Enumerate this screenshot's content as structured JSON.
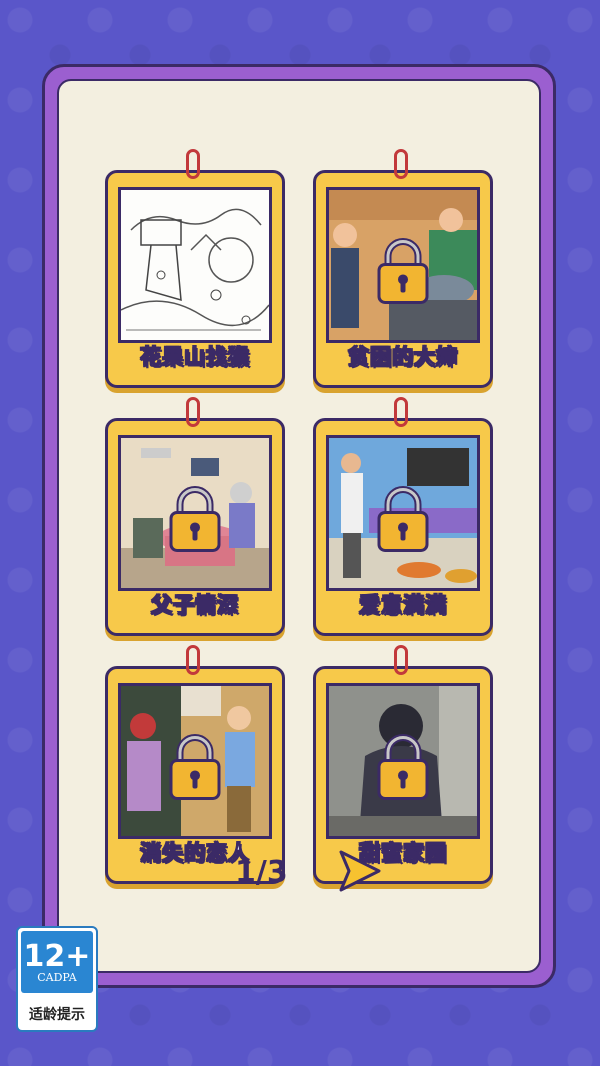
{
  "levels": [
    {
      "title": "花果山找猴",
      "locked": false
    },
    {
      "title": "贫困的大婶",
      "locked": true
    },
    {
      "title": "父子情深",
      "locked": true
    },
    {
      "title": "爱意满满",
      "locked": true
    },
    {
      "title": "消失的恋人",
      "locked": true
    },
    {
      "title": "甜蜜家园",
      "locked": true
    }
  ],
  "pager": {
    "text": "1/3"
  },
  "age_rating": {
    "value": "12+",
    "org": "CADPA",
    "tip": "适龄提示"
  },
  "colors": {
    "card": "#f7c94a",
    "outline": "#3b2a66",
    "board": "#9b5fd0",
    "background": "#5a56c9",
    "lock": "#f2b531"
  }
}
